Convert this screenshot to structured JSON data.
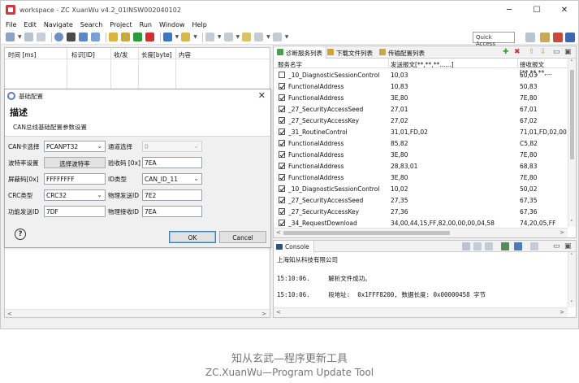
{
  "window": {
    "title": "workspace - ZC XuanWu v4.2_01INSW002040102",
    "minimize": "─",
    "maximize": "☐",
    "close": "✕"
  },
  "menu": [
    "File",
    "Edit",
    "Navigate",
    "Search",
    "Project",
    "Run",
    "Window",
    "Help"
  ],
  "toolbar": {
    "quick_access_placeholder": "Quick Access"
  },
  "left_table": {
    "columns": [
      "时间 [ms]",
      "标识[ID]",
      "收/发",
      "长度[byte]",
      "内容"
    ]
  },
  "dialog": {
    "title": "基础配置",
    "close": "✕",
    "heading": "描述",
    "subtitle": "CAN总线基础配置参数设置",
    "can_card_label": "CAN卡选择",
    "can_card_value": "PCANPT32",
    "channel_label": "通道选择",
    "channel_value": "0",
    "baud_label": "波特率设置",
    "baud_button": "选择波特率",
    "verify_code_label": "验收码 [0x]",
    "verify_code_value": "7EA",
    "mask_label": "屏蔽码[0x]",
    "mask_value": "FFFFFFFF",
    "id_type_label": "ID类型",
    "id_type_value": "CAN_ID_11",
    "crc_label": "CRC类型",
    "crc_value": "CRC32",
    "phys_send_label": "物理发送ID",
    "phys_send_value": "7E2",
    "func_send_label": "功能发送ID",
    "func_send_value": "7DF",
    "phys_recv_label": "物理接收ID",
    "phys_recv_value": "7EA",
    "help": "?",
    "ok": "OK",
    "cancel": "Cancel"
  },
  "right_panel": {
    "tabs": [
      "诊断服务列表",
      "下载文件列表",
      "传输配置列表"
    ],
    "columns": [
      "服务名字",
      "发送报文[**,**,**......]",
      "接收报文[**,**,**,..."
    ],
    "rows": [
      {
        "checked": false,
        "name": "_10_DiagnosticSessionControl",
        "send": "10,03",
        "recv": "50,03"
      },
      {
        "checked": true,
        "name": "FunctionalAddress",
        "send": "10,83",
        "recv": "50,83"
      },
      {
        "checked": true,
        "name": "FunctionalAddress",
        "send": "3E,80",
        "recv": "7E,80"
      },
      {
        "checked": true,
        "name": "_27_SecurityAccessSeed",
        "send": "27,01",
        "recv": "67,01"
      },
      {
        "checked": true,
        "name": "_27_SecurityAccessKey",
        "send": "27,02",
        "recv": "67,02"
      },
      {
        "checked": true,
        "name": "_31_RoutineControl",
        "send": "31,01,FD,02",
        "recv": "71,01,FD,02,00"
      },
      {
        "checked": true,
        "name": "FunctionalAddress",
        "send": "85,82",
        "recv": "C5,82"
      },
      {
        "checked": true,
        "name": "FunctionalAddress",
        "send": "3E,80",
        "recv": "7E,80"
      },
      {
        "checked": true,
        "name": "FunctionalAddress",
        "send": "28,83,01",
        "recv": "68,83"
      },
      {
        "checked": true,
        "name": "FunctionalAddress",
        "send": "3E,80",
        "recv": "7E,80"
      },
      {
        "checked": true,
        "name": "_10_DiagnosticSessionControl",
        "send": "10,02",
        "recv": "50,02"
      },
      {
        "checked": true,
        "name": "_27_SecurityAccessSeed",
        "send": "27,35",
        "recv": "67,35"
      },
      {
        "checked": true,
        "name": "_27_SecurityAccessKey",
        "send": "27,36",
        "recv": "67,36"
      },
      {
        "checked": true,
        "name": "_34_RequestDownload",
        "send": "34,00,44,15,FF,82,00,00,00,04,58",
        "recv": "74,20,05,FF"
      }
    ]
  },
  "console": {
    "tab": "Console",
    "company": "上海知从科技有限公司",
    "lines": [
      "15:10:06.     解析文件成功。",
      "15:10:06.     段地址:  0x1FFF8200, 数据长度: 0x00000458 字节"
    ]
  },
  "caption": {
    "cn": "知从玄武—程序更新工具",
    "en": "ZC.XuanWu—Program Update Tool"
  },
  "colors": {
    "app_bg": "#f0f0f0",
    "accent_blue": "#3c7fb1",
    "title_icon_red": "#d2383b"
  }
}
